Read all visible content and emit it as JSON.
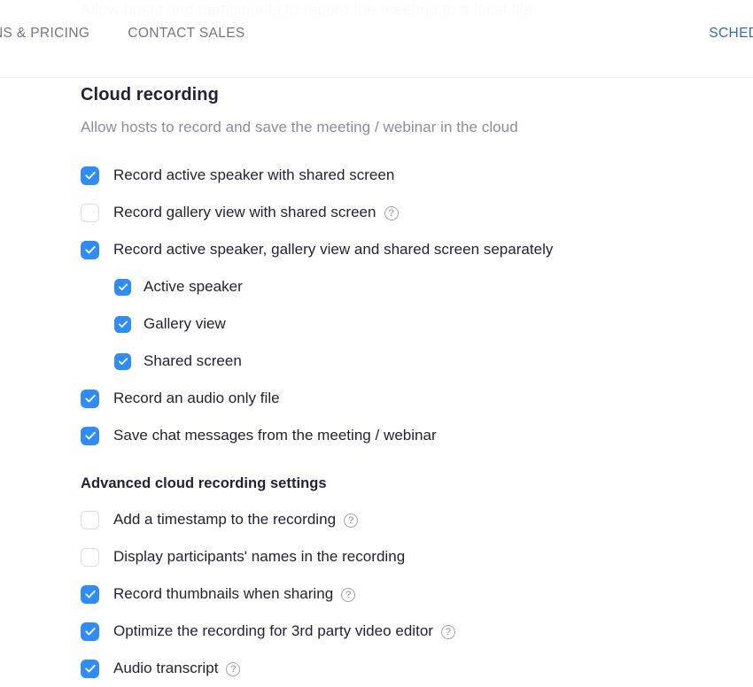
{
  "ghost_text": "Allow hosts and participants to record the meeting to a local file",
  "topnav": {
    "items": [
      {
        "label": "NS & PRICING"
      },
      {
        "label": "CONTACT SALES"
      }
    ],
    "cta_label": "SCHEDULE A"
  },
  "section": {
    "title": "Cloud recording",
    "description": "Allow hosts to record and save the meeting / webinar in the cloud"
  },
  "options": [
    {
      "label": "Record active speaker with shared screen",
      "checked": true,
      "help": false,
      "sub": false
    },
    {
      "label": "Record gallery view with shared screen",
      "checked": false,
      "help": true,
      "sub": false
    },
    {
      "label": "Record active speaker, gallery view and shared screen separately",
      "checked": true,
      "help": false,
      "sub": false
    },
    {
      "label": "Active speaker",
      "checked": true,
      "help": false,
      "sub": true
    },
    {
      "label": "Gallery view",
      "checked": true,
      "help": false,
      "sub": true
    },
    {
      "label": "Shared screen",
      "checked": true,
      "help": false,
      "sub": true
    },
    {
      "label": "Record an audio only file",
      "checked": true,
      "help": false,
      "sub": false
    },
    {
      "label": "Save chat messages from the meeting / webinar",
      "checked": true,
      "help": false,
      "sub": false
    }
  ],
  "advanced": {
    "title": "Advanced cloud recording settings",
    "options": [
      {
        "label": "Add a timestamp to the recording",
        "checked": false,
        "help": true,
        "sub": false
      },
      {
        "label": "Display participants' names in the recording",
        "checked": false,
        "help": false,
        "sub": false
      },
      {
        "label": "Record thumbnails when sharing",
        "checked": true,
        "help": true,
        "sub": false
      },
      {
        "label": "Optimize the recording for 3rd party video editor",
        "checked": true,
        "help": true,
        "sub": false
      },
      {
        "label": "Audio transcript",
        "checked": true,
        "help": true,
        "sub": false
      }
    ]
  },
  "help_icon_glyph": "?",
  "colors": {
    "accent_blue": "#2d8cff",
    "link_blue": "#2d6cb5",
    "text": "#232333",
    "muted": "#8c8c9c"
  }
}
